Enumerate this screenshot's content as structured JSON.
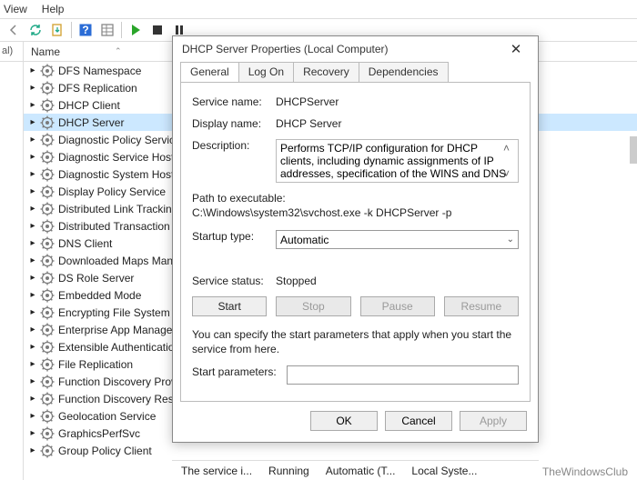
{
  "menu": {
    "view": "View",
    "help": "Help"
  },
  "left_head": "al)",
  "name_col_header": "Name",
  "services": [
    "DFS Namespace",
    "DFS Replication",
    "DHCP Client",
    "DHCP Server",
    "Diagnostic Policy Service",
    "Diagnostic Service Host",
    "Diagnostic System Host",
    "Display Policy Service",
    "Distributed Link Tracking C",
    "Distributed Transaction Co",
    "DNS Client",
    "Downloaded Maps Manag",
    "DS Role Server",
    "Embedded Mode",
    "Encrypting File System (EF",
    "Enterprise App Manageme",
    "Extensible Authentication",
    "File Replication",
    "Function Discovery Provide",
    "Function Discovery Resou",
    "Geolocation Service",
    "GraphicsPerfSvc",
    "Group Policy Client"
  ],
  "selected_index": 3,
  "dialog": {
    "title": "DHCP Server Properties (Local Computer)",
    "tabs": {
      "general": "General",
      "logon": "Log On",
      "recovery": "Recovery",
      "dependencies": "Dependencies"
    },
    "labels": {
      "service_name": "Service name:",
      "display_name": "Display name:",
      "description": "Description:",
      "path": "Path to executable:",
      "startup": "Startup type:",
      "status": "Service status:",
      "start_params": "Start parameters:"
    },
    "values": {
      "service_name": "DHCPServer",
      "display_name": "DHCP Server",
      "description": "Performs TCP/IP configuration for DHCP clients, including dynamic assignments of IP addresses, specification of the WINS and DNS servers, and",
      "path": "C:\\Windows\\system32\\svchost.exe -k DHCPServer -p",
      "startup": "Automatic",
      "status": "Stopped"
    },
    "buttons": {
      "start": "Start",
      "stop": "Stop",
      "pause": "Pause",
      "resume": "Resume"
    },
    "hint": "You can specify the start parameters that apply when you start the service from here.",
    "ok": "OK",
    "cancel": "Cancel",
    "apply": "Apply"
  },
  "status_bar": {
    "c0": "The service i...",
    "c1": "Running",
    "c2": "Automatic (T...",
    "c3": "Local Syste..."
  },
  "watermark": "TheWindowsClub"
}
